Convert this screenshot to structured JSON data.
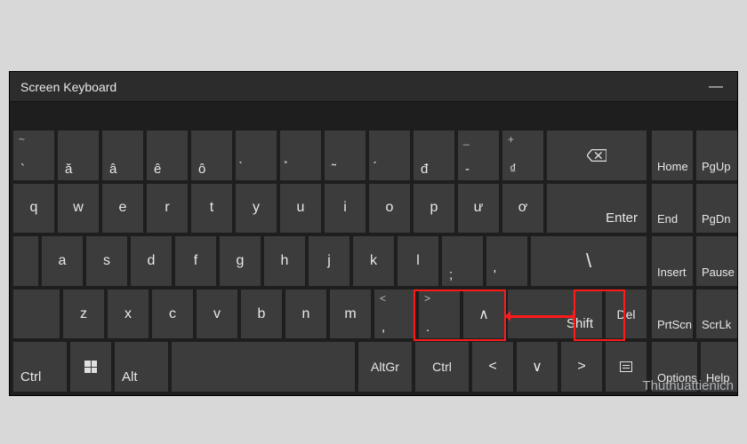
{
  "window": {
    "title": "Screen Keyboard"
  },
  "rows": {
    "r0": [
      {
        "u": "~",
        "l": "`"
      },
      {
        "u": "",
        "l": "ă"
      },
      {
        "u": "",
        "l": "â"
      },
      {
        "u": "",
        "l": "ê"
      },
      {
        "u": "",
        "l": "ô"
      },
      {
        "u": "",
        "l": "̀"
      },
      {
        "u": "",
        "l": "̉"
      },
      {
        "u": "",
        "l": "̃"
      },
      {
        "u": "",
        "l": "́"
      },
      {
        "u": "",
        "l": "đ"
      },
      {
        "u": "_",
        "l": "-"
      },
      {
        "u": "+",
        "l": "₫"
      }
    ],
    "r1": [
      "q",
      "w",
      "e",
      "r",
      "t",
      "y",
      "u",
      "i",
      "o",
      "p",
      "ư",
      "ơ"
    ],
    "r2": [
      "a",
      "s",
      "d",
      "f",
      "g",
      "h",
      "j",
      "k",
      "l",
      ";",
      "'",
      "\\"
    ],
    "r3_letters": [
      "z",
      "x",
      "c",
      "v",
      "b",
      "n",
      "m"
    ],
    "r3_punct1": {
      "u": "<",
      "l": ","
    },
    "r3_punct2": {
      "u": ">",
      "l": "."
    },
    "r3_punct3": {
      "u": "?",
      "l": "/"
    }
  },
  "keys": {
    "enter": "Enter",
    "shift": "Shift",
    "del": "Del",
    "ctrl": "Ctrl",
    "alt": "Alt",
    "altgr": "AltGr",
    "up": "∧",
    "down": "∨",
    "left": "<",
    "right": ">"
  },
  "nav": {
    "r0": [
      "Home",
      "PgUp"
    ],
    "r1": [
      "End",
      "PgDn"
    ],
    "r2": [
      "Insert",
      "Pause"
    ],
    "r3": [
      "PrtScn",
      "ScrLk"
    ],
    "r4": [
      "Options",
      "Help"
    ]
  },
  "watermark": "Thuthuattienich"
}
